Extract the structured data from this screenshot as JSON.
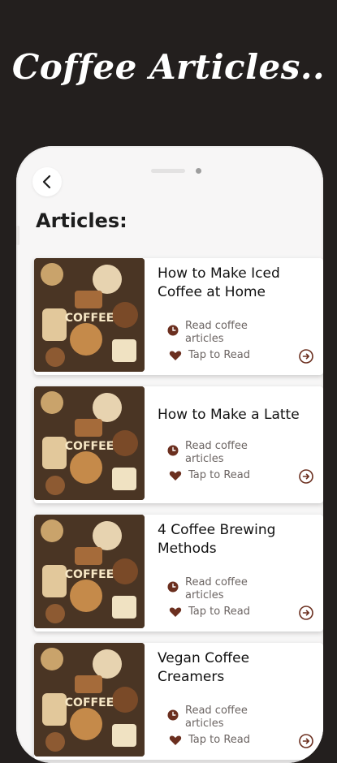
{
  "headline": "Coffee Articles..",
  "page_title": "Articles:",
  "colors": {
    "background": "#231f1e",
    "accent": "#6b2f1f",
    "phone": "#f7f6f6"
  },
  "articles": [
    {
      "title": "How to Make Iced Coffee at Home",
      "meta": "Read coffee articles",
      "action": "Tap to Read"
    },
    {
      "title": "How to Make a Latte",
      "meta": "Read coffee articles",
      "action": "Tap to Read"
    },
    {
      "title": "4 Coffee Brewing Methods",
      "meta": "Read coffee articles",
      "action": "Tap to Read"
    },
    {
      "title": "Vegan Coffee Creamers",
      "meta": "Read coffee articles",
      "action": "Tap to Read"
    }
  ],
  "thumbnail_text": "COFFEE",
  "icons": {
    "back": "chevron-left-icon",
    "time": "clock-icon",
    "favorite": "heart-icon",
    "open": "circle-arrow-icon"
  }
}
